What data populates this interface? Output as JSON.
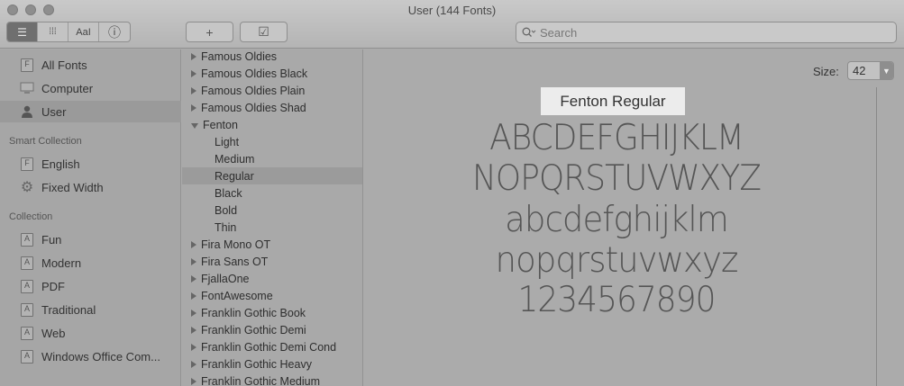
{
  "window": {
    "title": "User (144 Fonts)"
  },
  "toolbar": {
    "view_modes": [
      {
        "name": "list-view-button",
        "icon": "list-icon",
        "glyph": "☰"
      },
      {
        "name": "grid-view-button",
        "icon": "grid-icon",
        "glyph": "⁞⁞⁞"
      },
      {
        "name": "sample-view-button",
        "icon": "sample-text-icon",
        "glyph": "AaI"
      },
      {
        "name": "info-view-button",
        "icon": "info-icon",
        "glyph": "ⓘ"
      }
    ],
    "add_glyph": "+",
    "validate_glyph": "☑",
    "search_placeholder": "Search"
  },
  "sidebar": {
    "library": [
      {
        "label": "All Fonts",
        "icon": "font-box-icon"
      },
      {
        "label": "Computer",
        "icon": "computer-icon"
      },
      {
        "label": "User",
        "icon": "user-icon",
        "selected": true
      }
    ],
    "smart_collection_heading": "Smart Collection",
    "smart_collections": [
      {
        "label": "English",
        "icon": "font-box-icon"
      },
      {
        "label": "Fixed Width",
        "icon": "gear-icon"
      }
    ],
    "collection_heading": "Collection",
    "collections": [
      {
        "label": "Fun"
      },
      {
        "label": "Modern"
      },
      {
        "label": "PDF"
      },
      {
        "label": "Traditional"
      },
      {
        "label": "Web"
      },
      {
        "label": "Windows Office Com..."
      }
    ]
  },
  "font_list": [
    {
      "label": "Famous Oldies",
      "type": "family"
    },
    {
      "label": "Famous Oldies Black",
      "type": "family"
    },
    {
      "label": "Famous Oldies Plain",
      "type": "family"
    },
    {
      "label": "Famous Oldies Shad",
      "type": "family"
    },
    {
      "label": "Fenton",
      "type": "family-open"
    },
    {
      "label": "Light",
      "type": "style"
    },
    {
      "label": "Medium",
      "type": "style"
    },
    {
      "label": "Regular",
      "type": "style",
      "selected": true
    },
    {
      "label": "Black",
      "type": "style"
    },
    {
      "label": "Bold",
      "type": "style"
    },
    {
      "label": "Thin",
      "type": "style"
    },
    {
      "label": "Fira Mono OT",
      "type": "family"
    },
    {
      "label": "Fira Sans OT",
      "type": "family"
    },
    {
      "label": "FjallaOne",
      "type": "family"
    },
    {
      "label": "FontAwesome",
      "type": "family"
    },
    {
      "label": "Franklin Gothic Book",
      "type": "family"
    },
    {
      "label": "Franklin Gothic Demi",
      "type": "family"
    },
    {
      "label": "Franklin Gothic Demi Cond",
      "type": "family"
    },
    {
      "label": "Franklin Gothic Heavy",
      "type": "family"
    },
    {
      "label": "Franklin Gothic Medium",
      "type": "family"
    }
  ],
  "preview": {
    "size_label": "Size:",
    "size_value": "42",
    "font_name": "Fenton Regular",
    "sample_lines": [
      "ABCDEFGHIJKLM",
      "NOPQRSTUVWXYZ",
      "abcdefghijklm",
      "nopqrstuvwxyz",
      "1234567890"
    ]
  }
}
